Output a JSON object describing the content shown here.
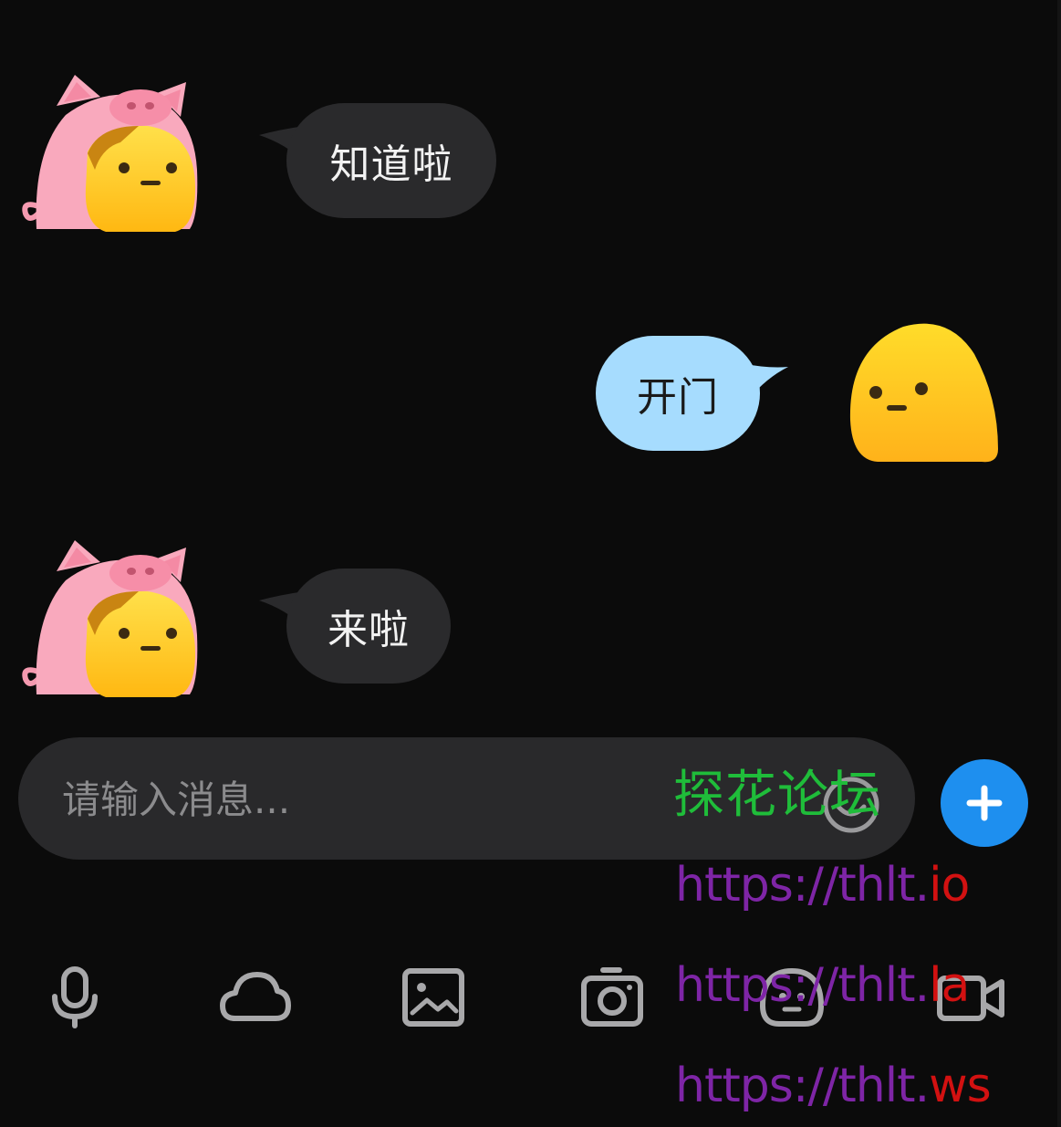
{
  "messages": [
    {
      "side": "incoming",
      "text": "知道啦",
      "avatar": "pig-hood-avatar-icon"
    },
    {
      "side": "outgoing",
      "text": "开门",
      "avatar": "yellow-blob-avatar-icon"
    },
    {
      "side": "incoming",
      "text": "来啦",
      "avatar": "pig-hood-avatar-icon"
    }
  ],
  "composer": {
    "placeholder": "请输入消息...",
    "emoji_icon": "smile-icon",
    "plus_icon": "plus-icon"
  },
  "toolbar": {
    "icons": [
      "microphone-icon",
      "cloud-icon",
      "image-icon",
      "camera-icon",
      "face-icon",
      "video-camera-icon"
    ]
  },
  "watermark": {
    "forum_name": "探花论坛",
    "urls": [
      {
        "main": "https://thlt.",
        "tld": "io"
      },
      {
        "main": "https://thlt.",
        "tld": "la"
      },
      {
        "main": "https://thlt.",
        "tld": "ws"
      }
    ]
  },
  "colors": {
    "background": "#0b0b0b",
    "incoming_bubble": "#2a2a2c",
    "outgoing_bubble": "#a6dcfe",
    "accent_blue": "#1e8fef",
    "watermark_green": "#1fbd3a",
    "watermark_purple": "#7e25a6",
    "watermark_red": "#d21111"
  }
}
